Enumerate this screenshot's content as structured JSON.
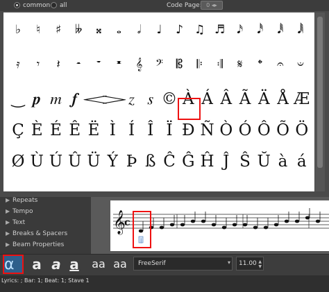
{
  "top_bar": {
    "common_label": "common",
    "all_label": "all",
    "code_page_label": "Code Page:",
    "code_page_value": "0"
  },
  "symbols": {
    "rows": [
      [
        "♭",
        "♮",
        "♯",
        "𝄫",
        "𝄪",
        "𝅝",
        "𝅗𝅥",
        "♩",
        "♪",
        "♫",
        "♬",
        "𝅘𝅥𝅯",
        "𝅘𝅥𝅰",
        "𝅘𝅥𝅱",
        "𝅘𝅥𝅲"
      ],
      [
        "𝄿",
        "𝄾",
        "𝄽",
        "𝄼",
        "𝄻",
        "𝄺",
        "𝄞",
        "𝄢",
        "𝄡",
        "𝄆",
        "𝄇",
        "𝄋",
        "𝄌",
        "𝄐",
        "𝄑"
      ],
      [
        "‿",
        "𝆏",
        "𝆐",
        "𝆑",
        "𝆒",
        "𝆓",
        "𝆎",
        "𝆍",
        "©",
        "À",
        "Á",
        "Â",
        "Ã",
        "Ä",
        "Å",
        "Æ"
      ],
      [
        "Ç",
        "È",
        "É",
        "Ê",
        "Ë",
        "Ì",
        "Í",
        "Î",
        "Ï",
        "Ð",
        "Ñ",
        "Ò",
        "Ó",
        "Ô",
        "Õ",
        "Ö"
      ],
      [
        "Ø",
        "Ù",
        "Ú",
        "Û",
        "Ü",
        "Ý",
        "Þ",
        "ß",
        "Ĉ",
        "Ĝ",
        "Ĥ",
        "Ĵ",
        "Ŝ",
        "Ŭ",
        "à",
        "á"
      ]
    ]
  },
  "sidebar": {
    "items": [
      "Repeats",
      "Tempo",
      "Text",
      "Breaks & Spacers",
      "Beam Properties"
    ]
  },
  "score": {
    "lyric_marker": "|"
  },
  "toolbar": {
    "alpha_label": "α",
    "style_a1": "a",
    "style_a2": "a",
    "style_a3": "a",
    "subscript_label": "aa",
    "superscript_label": "aa",
    "font_name": "FreeSerif",
    "font_size": "11.00"
  },
  "status_bar": {
    "text": "Lyrics: ; Bar: 1; Beat: 1; Stave 1"
  },
  "colors": {
    "highlight": "#ee1111",
    "accent": "#2e5f8c"
  }
}
